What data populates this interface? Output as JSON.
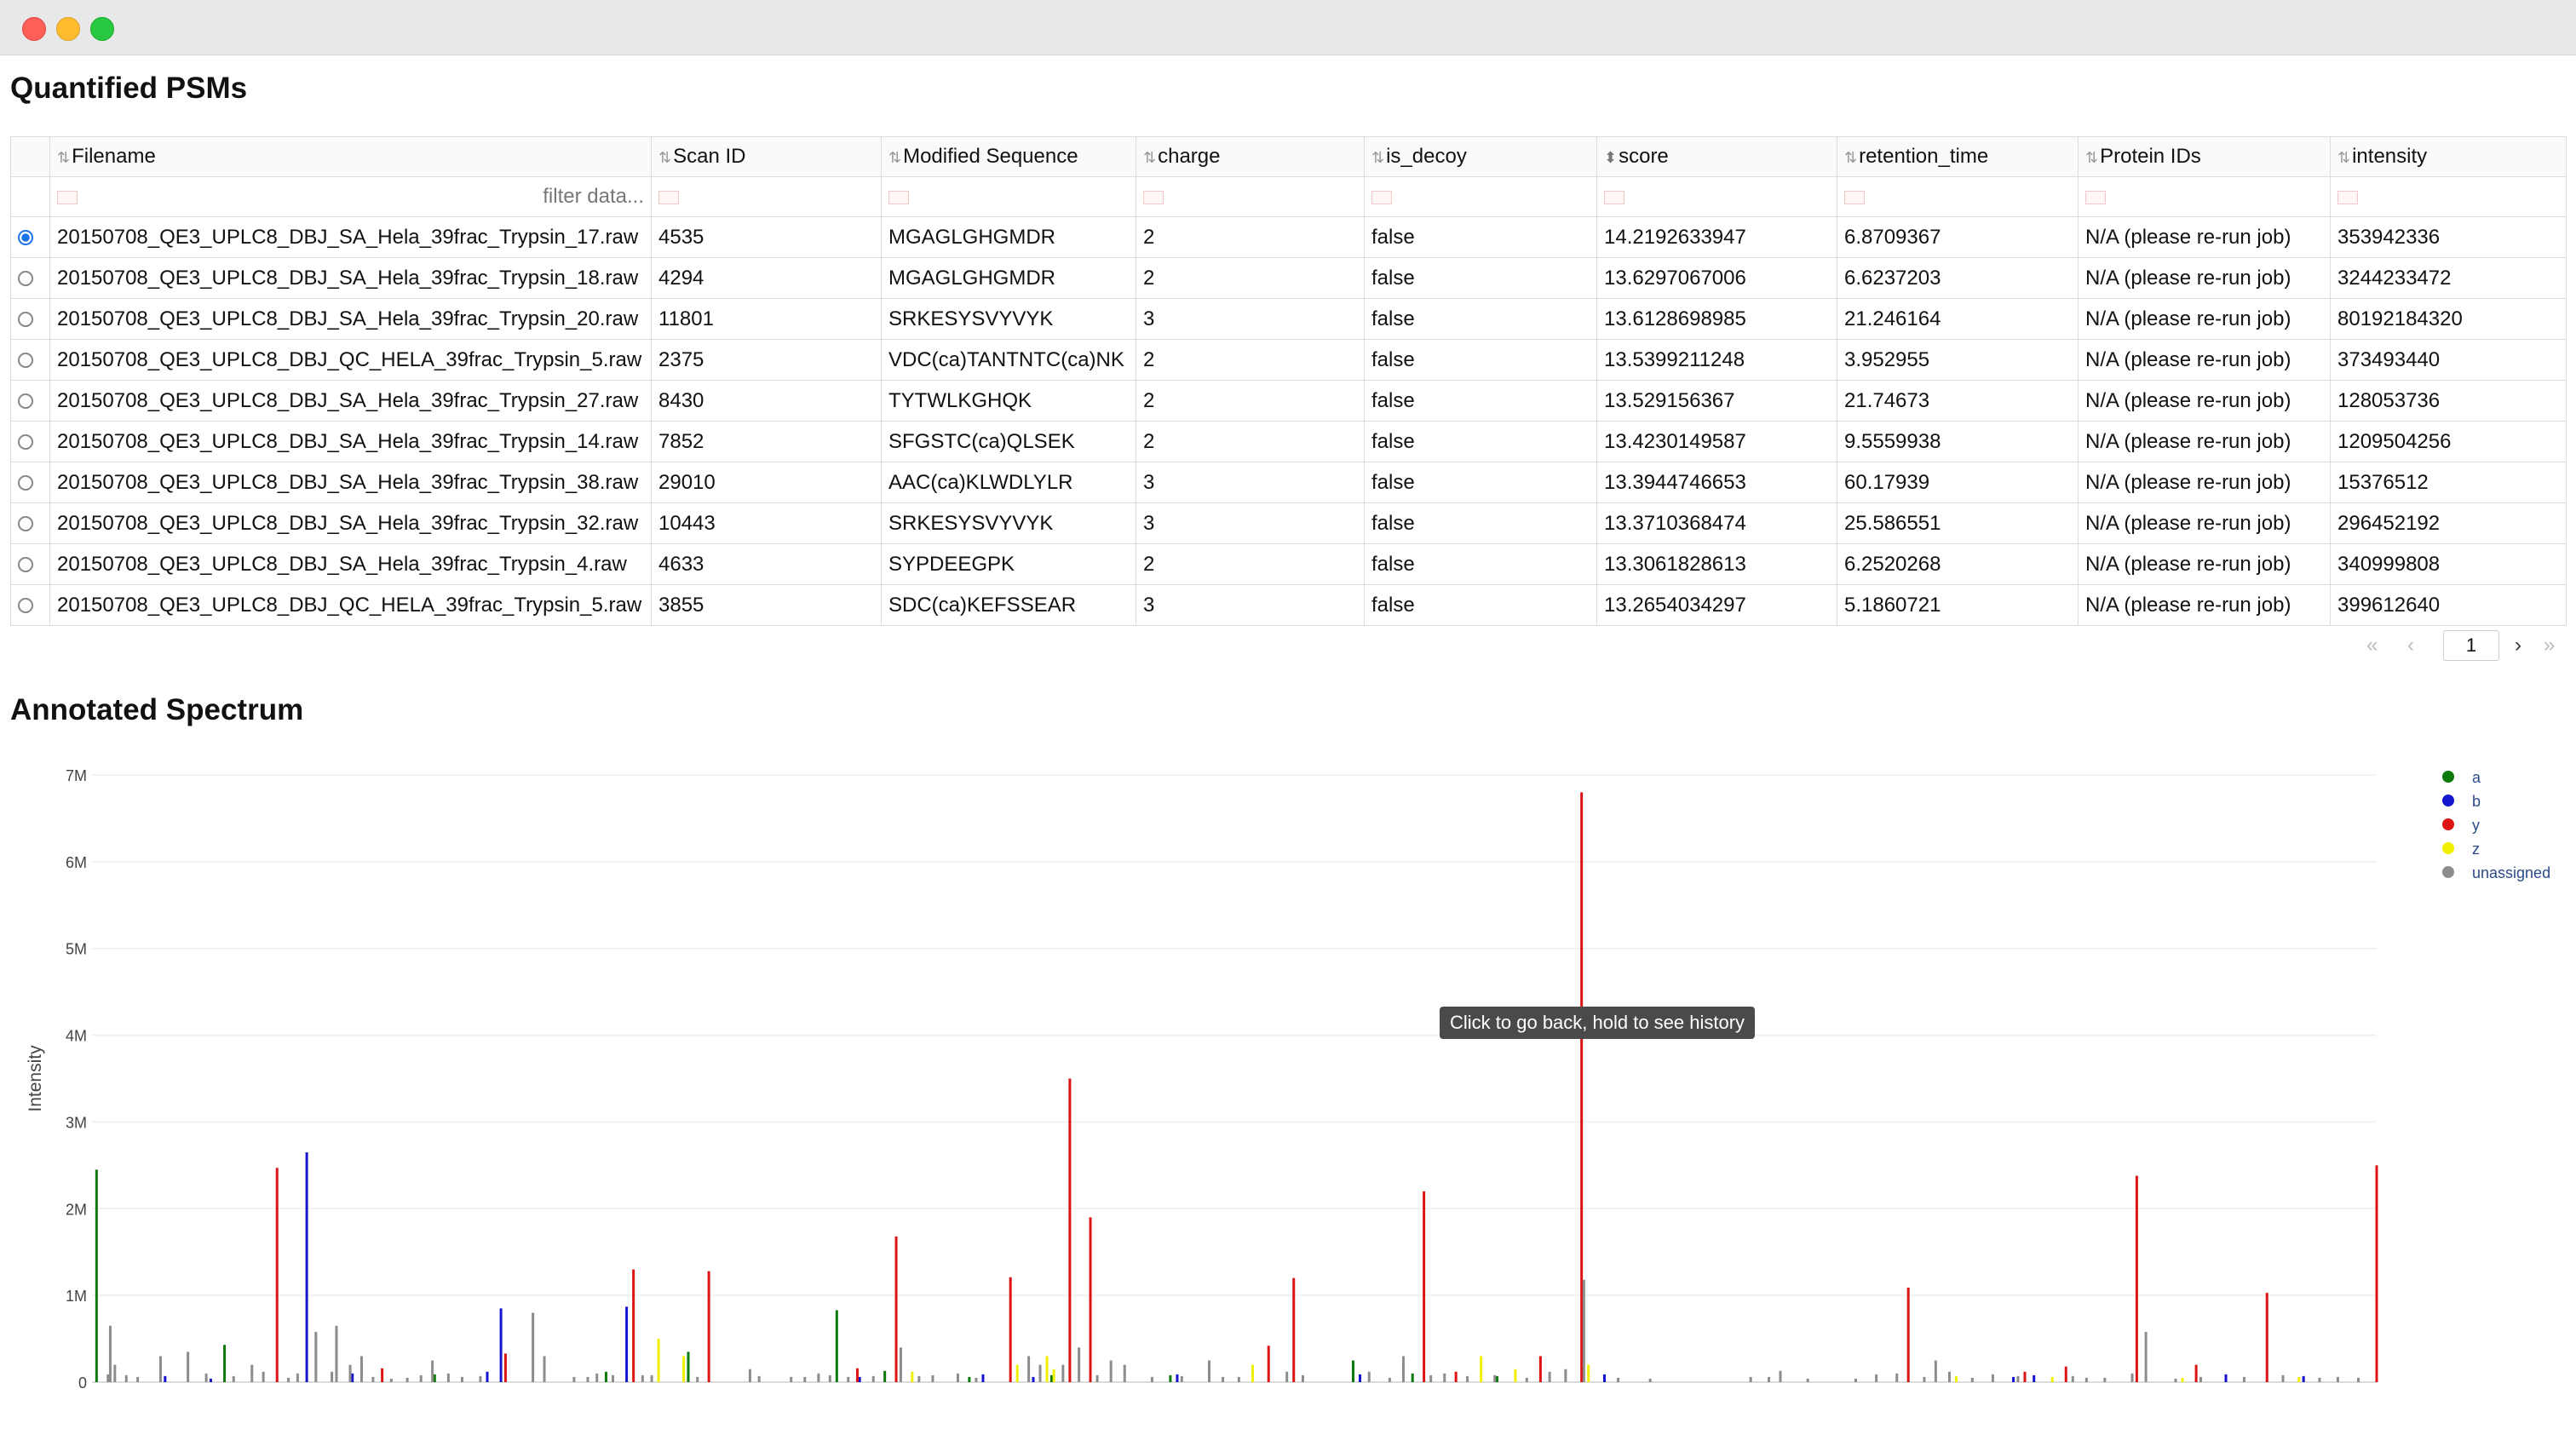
{
  "window": {
    "controls": [
      "close",
      "minimize",
      "zoom"
    ]
  },
  "psm_section": {
    "title": "Quantified PSMs"
  },
  "table": {
    "columns": [
      "Filename",
      "Scan ID",
      "Modified Sequence",
      "charge",
      "is_decoy",
      "score",
      "retention_time",
      "Protein IDs",
      "intensity"
    ],
    "active_sort_column": "score",
    "filter_placeholder": "filter data...",
    "selected_row": 0,
    "rows": [
      [
        "20150708_QE3_UPLC8_DBJ_SA_Hela_39frac_Trypsin_17.raw",
        "4535",
        "MGAGLGHGMDR",
        "2",
        "false",
        "14.2192633947",
        "6.8709367",
        "N/A (please re-run job)",
        "353942336"
      ],
      [
        "20150708_QE3_UPLC8_DBJ_SA_Hela_39frac_Trypsin_18.raw",
        "4294",
        "MGAGLGHGMDR",
        "2",
        "false",
        "13.6297067006",
        "6.6237203",
        "N/A (please re-run job)",
        "3244233472"
      ],
      [
        "20150708_QE3_UPLC8_DBJ_SA_Hela_39frac_Trypsin_20.raw",
        "11801",
        "SRKESYSVYVYK",
        "3",
        "false",
        "13.6128698985",
        "21.246164",
        "N/A (please re-run job)",
        "80192184320"
      ],
      [
        "20150708_QE3_UPLC8_DBJ_QC_HELA_39frac_Trypsin_5.raw",
        "2375",
        "VDC(ca)TANTNTC(ca)NK",
        "2",
        "false",
        "13.5399211248",
        "3.952955",
        "N/A (please re-run job)",
        "373493440"
      ],
      [
        "20150708_QE3_UPLC8_DBJ_SA_Hela_39frac_Trypsin_27.raw",
        "8430",
        "TYTWLKGHQK",
        "2",
        "false",
        "13.529156367",
        "21.74673",
        "N/A (please re-run job)",
        "128053736"
      ],
      [
        "20150708_QE3_UPLC8_DBJ_SA_Hela_39frac_Trypsin_14.raw",
        "7852",
        "SFGSTC(ca)QLSEK",
        "2",
        "false",
        "13.4230149587",
        "9.5559938",
        "N/A (please re-run job)",
        "1209504256"
      ],
      [
        "20150708_QE3_UPLC8_DBJ_SA_Hela_39frac_Trypsin_38.raw",
        "29010",
        "AAC(ca)KLWDLYLR",
        "3",
        "false",
        "13.3944746653",
        "60.17939",
        "N/A (please re-run job)",
        "15376512"
      ],
      [
        "20150708_QE3_UPLC8_DBJ_SA_Hela_39frac_Trypsin_32.raw",
        "10443",
        "SRKESYSVYVYK",
        "3",
        "false",
        "13.3710368474",
        "25.586551",
        "N/A (please re-run job)",
        "296452192"
      ],
      [
        "20150708_QE3_UPLC8_DBJ_SA_Hela_39frac_Trypsin_4.raw",
        "4633",
        "SYPDEEGPK",
        "2",
        "false",
        "13.3061828613",
        "6.2520268",
        "N/A (please re-run job)",
        "340999808"
      ],
      [
        "20150708_QE3_UPLC8_DBJ_QC_HELA_39frac_Trypsin_5.raw",
        "3855",
        "SDC(ca)KEFSSEAR",
        "3",
        "false",
        "13.2654034297",
        "5.1860721",
        "N/A (please re-run job)",
        "399612640"
      ]
    ]
  },
  "pagination": {
    "current_page": "1",
    "first_icon": "«",
    "prev_icon": "‹",
    "next_icon": "›",
    "last_icon": "»"
  },
  "spectrum_section": {
    "title": "Annotated Spectrum"
  },
  "tooltip": {
    "text": "Click to go back, hold to see history"
  },
  "chart_data": {
    "type": "bar",
    "ylabel": "Intensity",
    "xlabel": "",
    "ylim": [
      0,
      7000000
    ],
    "yticks": [
      "0",
      "1M",
      "2M",
      "3M",
      "4M",
      "5M",
      "6M",
      "7M"
    ],
    "grid": true,
    "legend_position": "top-right",
    "series": [
      {
        "name": "a",
        "color": "#0a7a0a",
        "peaks": [
          [
            0.2,
            2450000
          ],
          [
            5.8,
            430000
          ],
          [
            15,
            90000
          ],
          [
            22.5,
            120000
          ],
          [
            26.1,
            350000
          ],
          [
            32.6,
            830000
          ],
          [
            34.7,
            130000
          ],
          [
            38.4,
            60000
          ],
          [
            42,
            80000
          ],
          [
            47.2,
            80000
          ],
          [
            55.2,
            250000
          ],
          [
            57.8,
            100000
          ],
          [
            61.5,
            70000
          ]
        ]
      },
      {
        "name": "b",
        "color": "#1515d0",
        "peaks": [
          [
            3.2,
            70000
          ],
          [
            5.2,
            40000
          ],
          [
            9.4,
            2650000
          ],
          [
            11.4,
            100000
          ],
          [
            17.3,
            120000
          ],
          [
            17.9,
            850000
          ],
          [
            23.4,
            870000
          ],
          [
            33.6,
            60000
          ],
          [
            39,
            90000
          ],
          [
            41.2,
            60000
          ],
          [
            47.5,
            90000
          ],
          [
            55.5,
            90000
          ],
          [
            66.2,
            90000
          ],
          [
            84.1,
            60000
          ],
          [
            85,
            80000
          ],
          [
            93.4,
            90000
          ],
          [
            96.8,
            70000
          ]
        ]
      },
      {
        "name": "y",
        "color": "#dc1414",
        "peaks": [
          [
            8.1,
            2470000
          ],
          [
            12.7,
            160000
          ],
          [
            18.1,
            330000
          ],
          [
            23.7,
            1300000
          ],
          [
            27,
            1280000
          ],
          [
            33.5,
            160000
          ],
          [
            35.2,
            1680000
          ],
          [
            40.2,
            1210000
          ],
          [
            42.8,
            3500000
          ],
          [
            43.7,
            1900000
          ],
          [
            51.5,
            420000
          ],
          [
            52.6,
            1200000
          ],
          [
            58.3,
            2200000
          ],
          [
            59.7,
            120000
          ],
          [
            63.4,
            300000
          ],
          [
            65.2,
            6800000
          ],
          [
            79.5,
            1090000
          ],
          [
            84.6,
            120000
          ],
          [
            86.4,
            180000
          ],
          [
            89.5,
            2380000
          ],
          [
            92.1,
            200000
          ],
          [
            95.2,
            1030000
          ],
          [
            100,
            2500000
          ]
        ]
      },
      {
        "name": "z",
        "color": "#f0f000",
        "peaks": [
          [
            24.8,
            500000
          ],
          [
            25.9,
            300000
          ],
          [
            35.9,
            120000
          ],
          [
            40.5,
            200000
          ],
          [
            41.8,
            300000
          ],
          [
            42.1,
            150000
          ],
          [
            50.8,
            200000
          ],
          [
            60.8,
            300000
          ],
          [
            62.3,
            150000
          ],
          [
            65.5,
            200000
          ],
          [
            81.6,
            70000
          ],
          [
            85.8,
            60000
          ],
          [
            91.5,
            50000
          ],
          [
            96.6,
            60000
          ]
        ]
      },
      {
        "name": "unassigned",
        "color": "#8c8c8c",
        "peaks": [
          [
            0.7,
            90000
          ],
          [
            0.8,
            650000
          ],
          [
            1,
            200000
          ],
          [
            1.5,
            80000
          ],
          [
            2,
            60000
          ],
          [
            3,
            300000
          ],
          [
            4.2,
            350000
          ],
          [
            5,
            100000
          ],
          [
            6.2,
            70000
          ],
          [
            7,
            200000
          ],
          [
            7.5,
            120000
          ],
          [
            8.6,
            50000
          ],
          [
            9,
            100000
          ],
          [
            9.8,
            580000
          ],
          [
            10.5,
            120000
          ],
          [
            10.7,
            650000
          ],
          [
            11.3,
            200000
          ],
          [
            11.8,
            300000
          ],
          [
            12.3,
            60000
          ],
          [
            13.1,
            40000
          ],
          [
            13.8,
            50000
          ],
          [
            14.4,
            80000
          ],
          [
            14.9,
            250000
          ],
          [
            15.6,
            100000
          ],
          [
            16.2,
            60000
          ],
          [
            17,
            70000
          ],
          [
            19.3,
            800000
          ],
          [
            19.8,
            300000
          ],
          [
            21.1,
            60000
          ],
          [
            21.7,
            60000
          ],
          [
            22.1,
            100000
          ],
          [
            22.8,
            80000
          ],
          [
            24.1,
            80000
          ],
          [
            24.5,
            80000
          ],
          [
            26.5,
            60000
          ],
          [
            28.8,
            150000
          ],
          [
            29.2,
            70000
          ],
          [
            30.6,
            60000
          ],
          [
            31.2,
            60000
          ],
          [
            31.8,
            100000
          ],
          [
            32.3,
            80000
          ],
          [
            33.1,
            60000
          ],
          [
            34.2,
            70000
          ],
          [
            35.4,
            400000
          ],
          [
            36.2,
            70000
          ],
          [
            36.8,
            80000
          ],
          [
            37.9,
            100000
          ],
          [
            38.7,
            50000
          ],
          [
            41,
            300000
          ],
          [
            41.5,
            200000
          ],
          [
            42.5,
            200000
          ],
          [
            43.2,
            400000
          ],
          [
            44,
            80000
          ],
          [
            44.6,
            250000
          ],
          [
            45.2,
            200000
          ],
          [
            46.4,
            60000
          ],
          [
            47.7,
            70000
          ],
          [
            48.9,
            250000
          ],
          [
            49.5,
            60000
          ],
          [
            50.2,
            60000
          ],
          [
            52.3,
            120000
          ],
          [
            53,
            80000
          ],
          [
            55.9,
            120000
          ],
          [
            56.8,
            50000
          ],
          [
            57.4,
            300000
          ],
          [
            58.6,
            80000
          ],
          [
            59.2,
            100000
          ],
          [
            60.2,
            70000
          ],
          [
            61.4,
            80000
          ],
          [
            62.8,
            50000
          ],
          [
            63.8,
            120000
          ],
          [
            64.5,
            150000
          ],
          [
            65.3,
            1180000
          ],
          [
            66.8,
            50000
          ],
          [
            68.2,
            40000
          ],
          [
            72.6,
            60000
          ],
          [
            73.4,
            60000
          ],
          [
            73.9,
            130000
          ],
          [
            75.1,
            40000
          ],
          [
            77.2,
            40000
          ],
          [
            78.1,
            90000
          ],
          [
            79,
            100000
          ],
          [
            80.2,
            60000
          ],
          [
            80.7,
            250000
          ],
          [
            81.3,
            120000
          ],
          [
            82.3,
            50000
          ],
          [
            83.2,
            90000
          ],
          [
            84.3,
            70000
          ],
          [
            86.7,
            70000
          ],
          [
            87.3,
            50000
          ],
          [
            88.1,
            50000
          ],
          [
            89.3,
            100000
          ],
          [
            89.9,
            580000
          ],
          [
            91.2,
            40000
          ],
          [
            92.3,
            60000
          ],
          [
            94.2,
            60000
          ],
          [
            95.9,
            80000
          ],
          [
            97.5,
            50000
          ],
          [
            98.3,
            60000
          ],
          [
            99.2,
            50000
          ]
        ]
      }
    ]
  }
}
